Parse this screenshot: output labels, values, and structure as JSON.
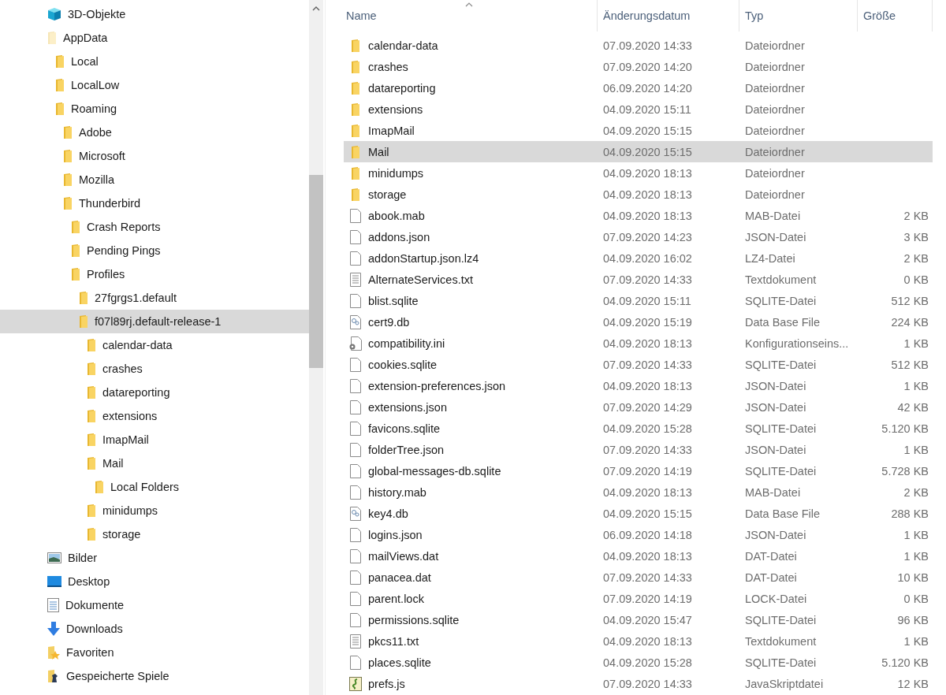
{
  "navigation_tree": [
    {
      "label": "3D-Objekte",
      "kind": "cube",
      "selected": false
    },
    {
      "label": "AppData",
      "kind": "hidden-folder",
      "selected": false,
      "children": [
        {
          "label": "Local",
          "kind": "folder",
          "selected": false
        },
        {
          "label": "LocalLow",
          "kind": "folder",
          "selected": false
        },
        {
          "label": "Roaming",
          "kind": "folder",
          "selected": false,
          "children": [
            {
              "label": "Adobe",
              "kind": "folder",
              "selected": false
            },
            {
              "label": "Microsoft",
              "kind": "folder",
              "selected": false
            },
            {
              "label": "Mozilla",
              "kind": "folder",
              "selected": false
            },
            {
              "label": "Thunderbird",
              "kind": "folder",
              "selected": false,
              "children": [
                {
                  "label": "Crash Reports",
                  "kind": "folder",
                  "selected": false
                },
                {
                  "label": "Pending Pings",
                  "kind": "folder",
                  "selected": false
                },
                {
                  "label": "Profiles",
                  "kind": "folder",
                  "selected": false,
                  "children": [
                    {
                      "label": "27fgrgs1.default",
                      "kind": "folder",
                      "selected": false
                    },
                    {
                      "label": "f07l89rj.default-release-1",
                      "kind": "folder",
                      "selected": true,
                      "children": [
                        {
                          "label": "calendar-data",
                          "kind": "folder",
                          "selected": false
                        },
                        {
                          "label": "crashes",
                          "kind": "folder",
                          "selected": false
                        },
                        {
                          "label": "datareporting",
                          "kind": "folder",
                          "selected": false
                        },
                        {
                          "label": "extensions",
                          "kind": "folder",
                          "selected": false
                        },
                        {
                          "label": "ImapMail",
                          "kind": "folder",
                          "selected": false
                        },
                        {
                          "label": "Mail",
                          "kind": "folder",
                          "selected": false,
                          "children": [
                            {
                              "label": "Local Folders",
                              "kind": "folder",
                              "selected": false
                            }
                          ]
                        },
                        {
                          "label": "minidumps",
                          "kind": "folder",
                          "selected": false
                        },
                        {
                          "label": "storage",
                          "kind": "folder",
                          "selected": false
                        }
                      ]
                    }
                  ]
                }
              ]
            }
          ]
        }
      ]
    },
    {
      "label": "Bilder",
      "kind": "pictures",
      "selected": false
    },
    {
      "label": "Desktop",
      "kind": "desktop",
      "selected": false
    },
    {
      "label": "Dokumente",
      "kind": "documents",
      "selected": false
    },
    {
      "label": "Downloads",
      "kind": "downloads",
      "selected": false
    },
    {
      "label": "Favoriten",
      "kind": "favorites",
      "selected": false
    },
    {
      "label": "Gespeicherte Spiele",
      "kind": "games",
      "selected": false
    }
  ],
  "file_list": {
    "columns": [
      "Name",
      "Änderungsdatum",
      "Typ",
      "Größe"
    ],
    "rows": [
      {
        "name": "calendar-data",
        "date": "07.09.2020 14:33",
        "type": "Dateiordner",
        "kind": "folder",
        "selected": false
      },
      {
        "name": "crashes",
        "date": "07.09.2020 14:20",
        "type": "Dateiordner",
        "kind": "folder",
        "selected": false
      },
      {
        "name": "datareporting",
        "date": "06.09.2020 14:20",
        "type": "Dateiordner",
        "kind": "folder",
        "selected": false
      },
      {
        "name": "extensions",
        "date": "04.09.2020 15:11",
        "type": "Dateiordner",
        "kind": "folder",
        "selected": false
      },
      {
        "name": "ImapMail",
        "date": "04.09.2020 15:15",
        "type": "Dateiordner",
        "kind": "folder",
        "selected": false
      },
      {
        "name": "Mail",
        "date": "04.09.2020 15:15",
        "type": "Dateiordner",
        "kind": "folder",
        "selected": true
      },
      {
        "name": "minidumps",
        "date": "04.09.2020 18:13",
        "type": "Dateiordner",
        "kind": "folder",
        "selected": false
      },
      {
        "name": "storage",
        "date": "04.09.2020 18:13",
        "type": "Dateiordner",
        "kind": "folder",
        "selected": false
      },
      {
        "name": "abook.mab",
        "date": "04.09.2020 18:13",
        "type": "MAB-Datei",
        "size": "2 KB",
        "kind": "file",
        "selected": false
      },
      {
        "name": "addons.json",
        "date": "07.09.2020 14:23",
        "type": "JSON-Datei",
        "size": "3 KB",
        "kind": "file",
        "selected": false
      },
      {
        "name": "addonStartup.json.lz4",
        "date": "04.09.2020 16:02",
        "type": "LZ4-Datei",
        "size": "2 KB",
        "kind": "file",
        "selected": false
      },
      {
        "name": "AlternateServices.txt",
        "date": "07.09.2020 14:33",
        "type": "Textdokument",
        "size": "0 KB",
        "kind": "text",
        "selected": false
      },
      {
        "name": "blist.sqlite",
        "date": "04.09.2020 15:11",
        "type": "SQLITE-Datei",
        "size": "512 KB",
        "kind": "file",
        "selected": false
      },
      {
        "name": "cert9.db",
        "date": "04.09.2020 15:19",
        "type": "Data Base File",
        "size": "224 KB",
        "kind": "database",
        "selected": false
      },
      {
        "name": "compatibility.ini",
        "date": "04.09.2020 18:13",
        "type": "Konfigurationseins...",
        "size": "1 KB",
        "kind": "settings",
        "selected": false
      },
      {
        "name": "cookies.sqlite",
        "date": "07.09.2020 14:33",
        "type": "SQLITE-Datei",
        "size": "512 KB",
        "kind": "file",
        "selected": false
      },
      {
        "name": "extension-preferences.json",
        "date": "04.09.2020 18:13",
        "type": "JSON-Datei",
        "size": "1 KB",
        "kind": "file",
        "selected": false
      },
      {
        "name": "extensions.json",
        "date": "07.09.2020 14:29",
        "type": "JSON-Datei",
        "size": "42 KB",
        "kind": "file",
        "selected": false
      },
      {
        "name": "favicons.sqlite",
        "date": "04.09.2020 15:28",
        "type": "SQLITE-Datei",
        "size": "5.120 KB",
        "kind": "file",
        "selected": false
      },
      {
        "name": "folderTree.json",
        "date": "07.09.2020 14:33",
        "type": "JSON-Datei",
        "size": "1 KB",
        "kind": "file",
        "selected": false
      },
      {
        "name": "global-messages-db.sqlite",
        "date": "07.09.2020 14:19",
        "type": "SQLITE-Datei",
        "size": "5.728 KB",
        "kind": "file",
        "selected": false
      },
      {
        "name": "history.mab",
        "date": "04.09.2020 18:13",
        "type": "MAB-Datei",
        "size": "2 KB",
        "kind": "file",
        "selected": false
      },
      {
        "name": "key4.db",
        "date": "04.09.2020 15:15",
        "type": "Data Base File",
        "size": "288 KB",
        "kind": "database",
        "selected": false
      },
      {
        "name": "logins.json",
        "date": "06.09.2020 14:18",
        "type": "JSON-Datei",
        "size": "1 KB",
        "kind": "file",
        "selected": false
      },
      {
        "name": "mailViews.dat",
        "date": "04.09.2020 18:13",
        "type": "DAT-Datei",
        "size": "1 KB",
        "kind": "file",
        "selected": false
      },
      {
        "name": "panacea.dat",
        "date": "07.09.2020 14:33",
        "type": "DAT-Datei",
        "size": "10 KB",
        "kind": "file",
        "selected": false
      },
      {
        "name": "parent.lock",
        "date": "07.09.2020 14:19",
        "type": "LOCK-Datei",
        "size": "0 KB",
        "kind": "file",
        "selected": false
      },
      {
        "name": "permissions.sqlite",
        "date": "04.09.2020 15:47",
        "type": "SQLITE-Datei",
        "size": "96 KB",
        "kind": "file",
        "selected": false
      },
      {
        "name": "pkcs11.txt",
        "date": "04.09.2020 18:13",
        "type": "Textdokument",
        "size": "1 KB",
        "kind": "text",
        "selected": false
      },
      {
        "name": "places.sqlite",
        "date": "04.09.2020 15:28",
        "type": "SQLITE-Datei",
        "size": "5.120 KB",
        "kind": "file",
        "selected": false
      },
      {
        "name": "prefs.js",
        "date": "07.09.2020 14:33",
        "type": "JavaSkriptdatei",
        "size": "12 KB",
        "kind": "script",
        "selected": false
      }
    ]
  }
}
